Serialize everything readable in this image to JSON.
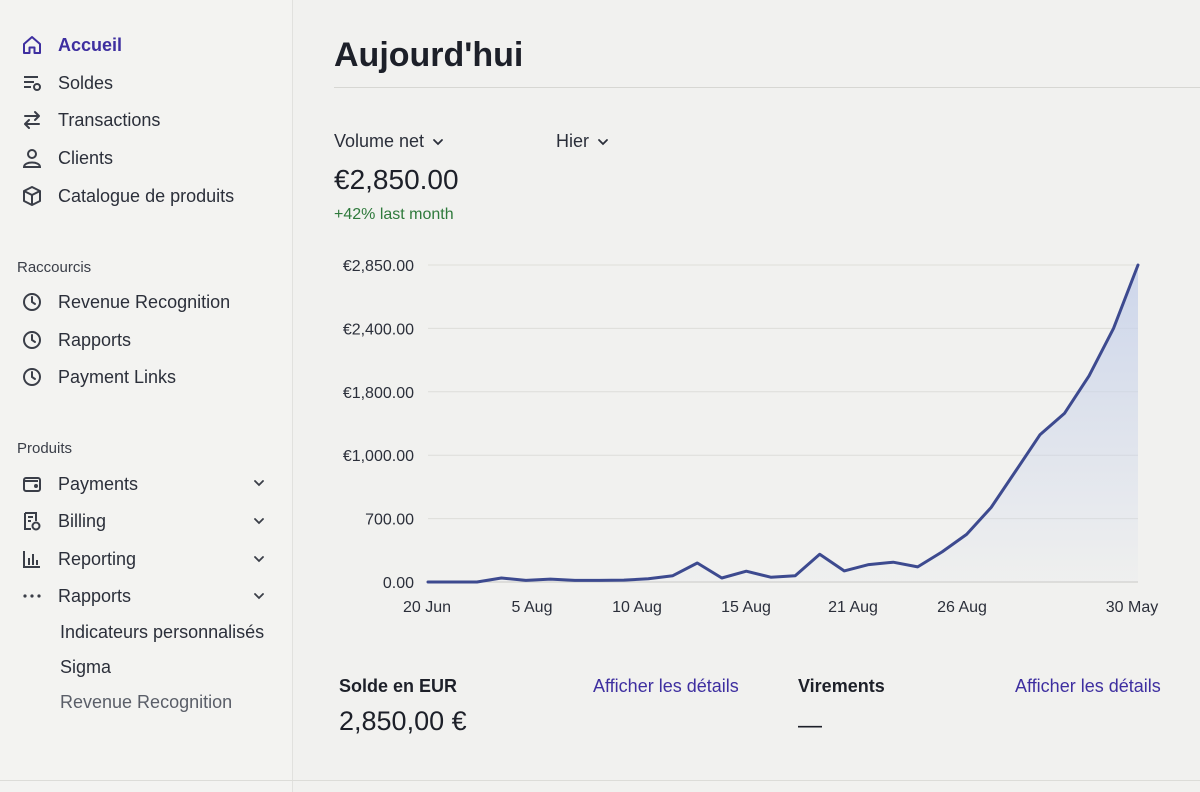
{
  "sidebar": {
    "main_nav": [
      {
        "label": "Accueil",
        "icon": "home-icon",
        "active": true
      },
      {
        "label": "Soldes",
        "icon": "balances-icon"
      },
      {
        "label": "Transactions",
        "icon": "transfer-arrows-icon"
      },
      {
        "label": "Clients",
        "icon": "person-icon"
      },
      {
        "label": "Catalogue de produits",
        "icon": "box-icon"
      }
    ],
    "shortcuts_title": "Raccourcis",
    "shortcuts": [
      {
        "label": "Revenue Recognition",
        "icon": "clock-icon"
      },
      {
        "label": "Rapports",
        "icon": "clock-icon"
      },
      {
        "label": "Payment Links",
        "icon": "clock-icon"
      }
    ],
    "products_title": "Produits",
    "products": [
      {
        "label": "Payments",
        "icon": "wallet-icon"
      },
      {
        "label": "Billing",
        "icon": "invoice-icon"
      },
      {
        "label": "Reporting",
        "icon": "bar-chart-icon"
      },
      {
        "label": "Rapports",
        "icon": "more-dots-icon"
      }
    ],
    "rapports_children": [
      "Indicateurs personnalisés",
      "Sigma",
      "Revenue Recognition"
    ]
  },
  "main": {
    "title": "Aujourd'hui",
    "metric_dropdown": "Volume net",
    "period_dropdown": "Hier",
    "value": "€2,850.00",
    "delta": "+42% last month",
    "balance": {
      "label": "Solde en EUR",
      "link": "Afficher les détails",
      "value": "2,850,00 €"
    },
    "transfers": {
      "label": "Virements",
      "link": "Afficher les détails",
      "value": "—"
    }
  },
  "chart_data": {
    "type": "area",
    "y_tick_labels": [
      "0.00",
      "700.00",
      "€1,000.00",
      "€1,800.00",
      "€2,400.00",
      "€2,850.00"
    ],
    "x_tick_labels": [
      "20 Jun",
      "5 Aug",
      "10 Aug",
      "15 Aug",
      "21 Aug",
      "26 Aug",
      "30 May"
    ],
    "series": [
      {
        "color": "#3d4a8f",
        "values": [
          0,
          0,
          0,
          25,
          10,
          18,
          10,
          10,
          12,
          20,
          40,
          120,
          25,
          68,
          30,
          40,
          175,
          70,
          110,
          125,
          95,
          190,
          300,
          470,
          700,
          930,
          1065,
          1300,
          1600,
          2000
        ]
      }
    ],
    "line_color": "#3d4a8f",
    "fill_color": "#c9d3ea",
    "grid": true
  },
  "colors": {
    "accent": "#3e2fa0",
    "positive": "#2f7a3c",
    "line": "#3d4a8f"
  }
}
